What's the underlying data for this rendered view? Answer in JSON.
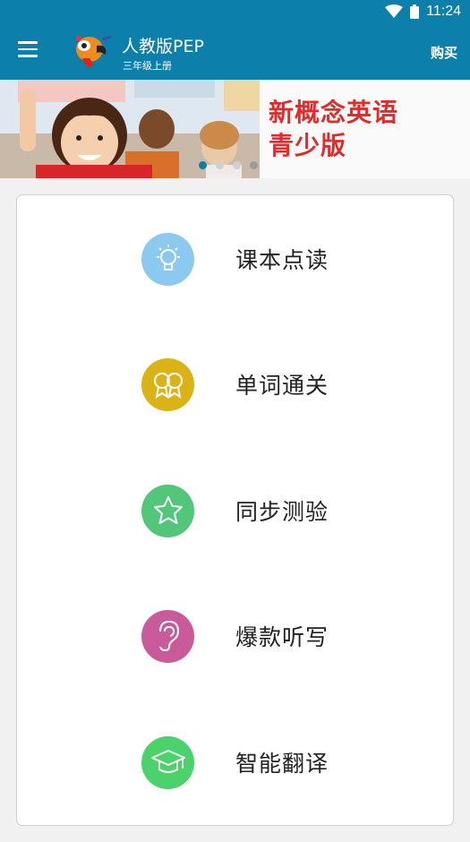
{
  "status": {
    "time": "11:24",
    "wifi_icon": "wifi-icon",
    "battery_icon": "battery-icon"
  },
  "header": {
    "title": "人教版PEP",
    "subtitle": "三年级上册",
    "buy_label": "购买",
    "menu_icon": "hamburger-menu-icon",
    "logo": "parrot-logo"
  },
  "banner": {
    "line1": "新概念英语",
    "line2": "青少版",
    "pages": 4,
    "active_page": 1
  },
  "menu": {
    "items": [
      {
        "label": "课本点读",
        "icon": "lightbulb-icon",
        "color": "#8cc9ef"
      },
      {
        "label": "单词通关",
        "icon": "award-ribbons-icon",
        "color": "#dbb316"
      },
      {
        "label": "同步测验",
        "icon": "star-icon",
        "color": "#52c77a"
      },
      {
        "label": "爆款听写",
        "icon": "ear-icon",
        "color": "#c95b9a"
      },
      {
        "label": "智能翻译",
        "icon": "graduation-cap-icon",
        "color": "#49d36a"
      }
    ]
  },
  "colors": {
    "primary": "#0d7fab",
    "card_border": "#cfcfcf",
    "banner_text": "#e32b2b"
  }
}
